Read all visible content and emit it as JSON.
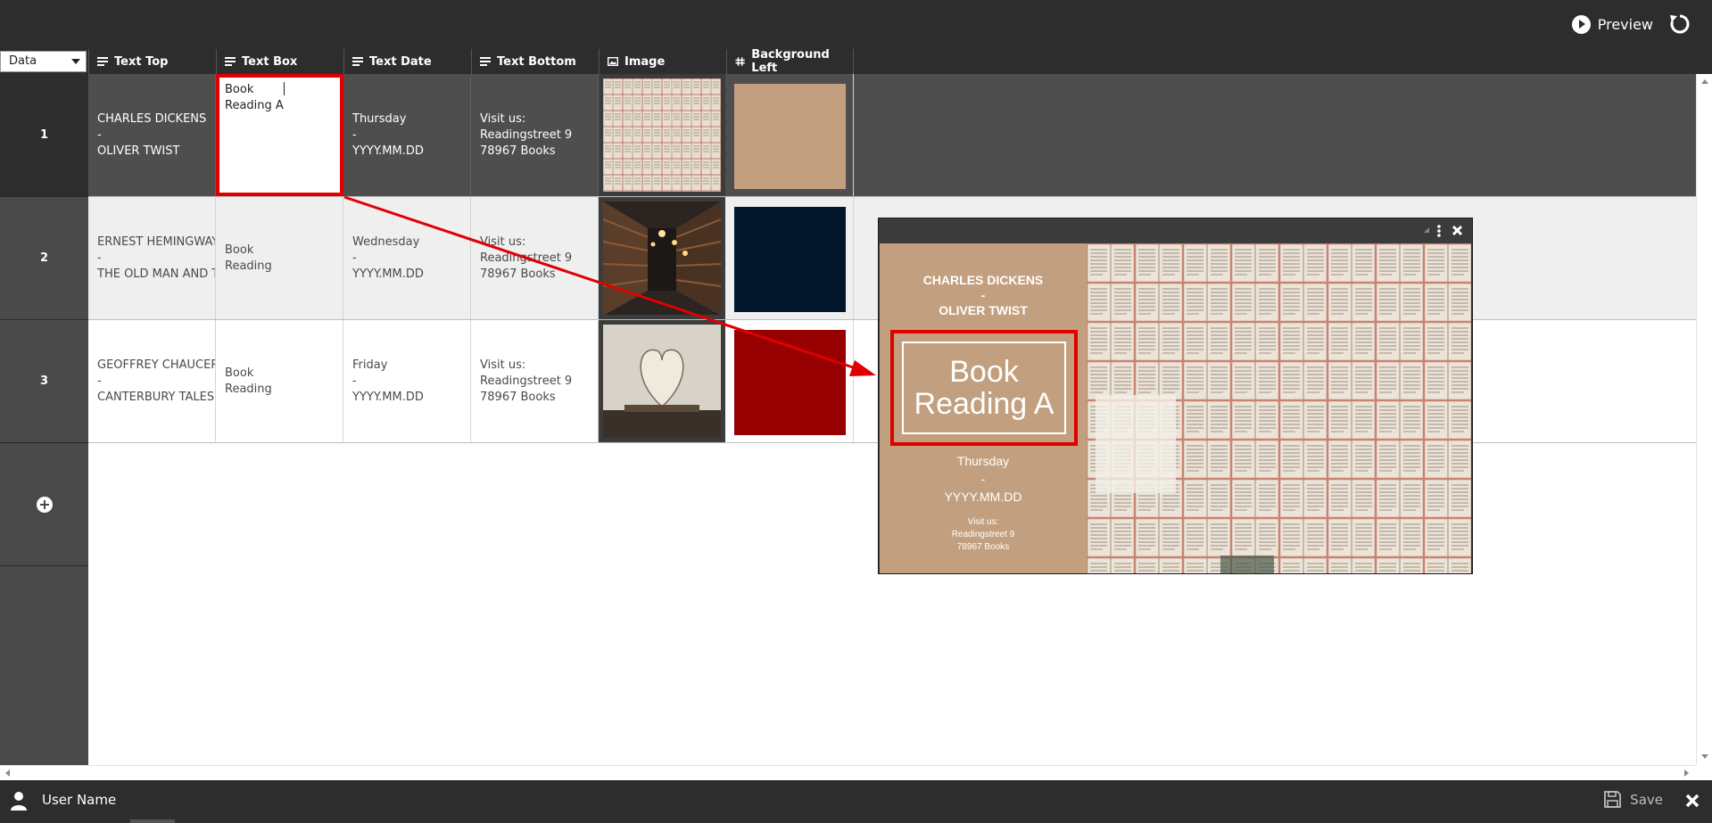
{
  "toolbar": {
    "preview_label": "Preview"
  },
  "data_select": {
    "value": "Data"
  },
  "columns": [
    {
      "label": "Text Top"
    },
    {
      "label": "Text Box"
    },
    {
      "label": "Text Date"
    },
    {
      "label": "Text Bottom"
    },
    {
      "label": "Image"
    },
    {
      "label": "Background Left"
    }
  ],
  "rows": [
    {
      "num": "1",
      "text_top": "CHARLES DICKENS\n-\nOLIVER TWIST",
      "text_box": "Book\nReading A",
      "text_date": "Thursday\n-\nYYYY.MM.DD",
      "text_bottom": "Visit us:\nReadingstreet 9\n78967 Books",
      "image": "open-books-collage",
      "background": "#c2a07f"
    },
    {
      "num": "2",
      "text_top": "ERNEST HEMINGWAY\n-\nTHE OLD MAN AND THE SEA",
      "text_box": "Book\nReading",
      "text_date": "Wednesday\n-\nYYYY.MM.DD",
      "text_bottom": "Visit us:\nReadingstreet 9\n78967 Books",
      "image": "library-shelves",
      "background": "#02172b"
    },
    {
      "num": "3",
      "text_top": "GEOFFREY CHAUCER\n-\nCANTERBURY TALES",
      "text_box": "Book\nReading",
      "text_date": "Friday\n-\nYYYY.MM.DD",
      "text_bottom": "Visit us:\nReadingstreet 9\n78967 Books",
      "image": "heart-book",
      "background": "#970000"
    }
  ],
  "preview": {
    "text_top": "CHARLES DICKENS\n-\nOLIVER TWIST",
    "text_box": "Book\nReading A",
    "text_date": "Thursday\n-\nYYYY.MM.DD",
    "text_bottom": "Visit us:\nReadingstreet 9\n78967 Books",
    "background": "#c2a07f"
  },
  "footer": {
    "user_name": "User Name",
    "save_label": "Save"
  },
  "colors": {
    "highlight": "#e00000",
    "bar": "#2d2d2d",
    "rownum_bg": "#4a4a4a"
  }
}
